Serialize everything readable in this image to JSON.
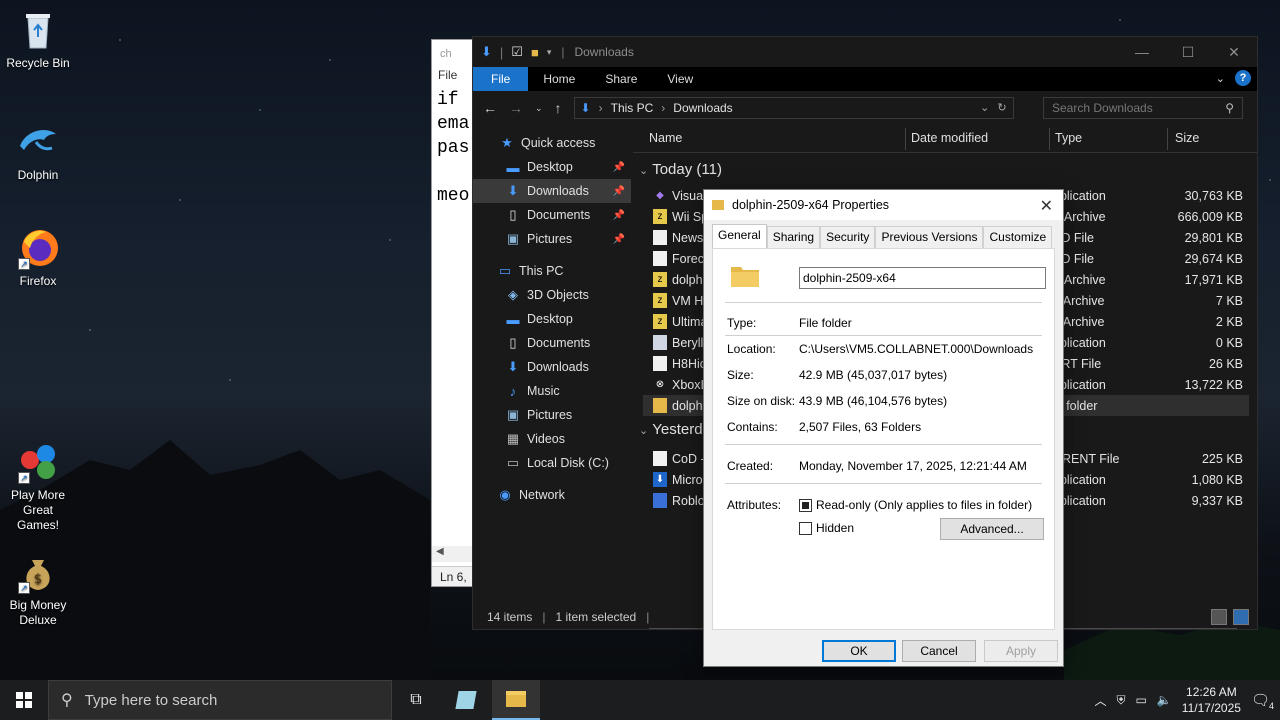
{
  "desktop": {
    "icons": [
      {
        "label": "Recycle Bin"
      },
      {
        "label": "Dolphin"
      },
      {
        "label": "Firefox"
      },
      {
        "label": "Play More Great Games!"
      },
      {
        "label": "Big Money Deluxe"
      }
    ]
  },
  "notepad": {
    "title": "ch",
    "menu": "File",
    "lines": [
      "if ",
      "",
      "ema",
      "pas",
      "",
      "meo"
    ],
    "status": "Ln 6, C"
  },
  "explorer": {
    "title": "Downloads",
    "ribbon": {
      "file": "File",
      "home": "Home",
      "share": "Share",
      "view": "View",
      "help": "?"
    },
    "address": {
      "crumb1": "This PC",
      "crumb2": "Downloads"
    },
    "search_placeholder": "Search Downloads",
    "nav": [
      {
        "label": "Quick access",
        "icon": "star-icon"
      },
      {
        "label": "Desktop",
        "icon": "desktop-icon",
        "pinned": true
      },
      {
        "label": "Downloads",
        "icon": "download-icon",
        "pinned": true
      },
      {
        "label": "Documents",
        "icon": "document-icon",
        "pinned": true
      },
      {
        "label": "Pictures",
        "icon": "pictures-icon",
        "pinned": true
      },
      {
        "label": "This PC",
        "icon": "computer-icon"
      },
      {
        "label": "3D Objects",
        "icon": "cube-icon"
      },
      {
        "label": "Desktop",
        "icon": "desktop-icon"
      },
      {
        "label": "Documents",
        "icon": "document-icon"
      },
      {
        "label": "Downloads",
        "icon": "download-icon"
      },
      {
        "label": "Music",
        "icon": "music-icon"
      },
      {
        "label": "Pictures",
        "icon": "pictures-icon"
      },
      {
        "label": "Videos",
        "icon": "video-icon"
      },
      {
        "label": "Local Disk (C:)",
        "icon": "drive-icon"
      },
      {
        "label": "Network",
        "icon": "network-icon"
      }
    ],
    "columns": {
      "name": "Name",
      "date": "Date modified",
      "type": "Type",
      "size": "Size"
    },
    "groups": {
      "today": "Today (11)",
      "yesterday": "Yesterd"
    },
    "today_rows": [
      {
        "name": "Visual",
        "type": "pplication",
        "size": "30,763 KB"
      },
      {
        "name": "Wii Sp",
        "type": "P Archive",
        "size": "666,009 KB"
      },
      {
        "name": "News",
        "type": "AD File",
        "size": "29,801 KB"
      },
      {
        "name": "Foreca",
        "type": "AD File",
        "size": "29,674 KB"
      },
      {
        "name": "dolph",
        "type": "P Archive",
        "size": "17,971 KB"
      },
      {
        "name": "VM HA",
        "type": "p Archive",
        "size": "7 KB"
      },
      {
        "name": "Ultima",
        "type": "p Archive",
        "size": "2 KB"
      },
      {
        "name": "Berylli",
        "type": "pplication",
        "size": "0 KB"
      },
      {
        "name": "H8Hic",
        "type": "ART File",
        "size": "26 KB"
      },
      {
        "name": "XboxIr",
        "type": "pplication",
        "size": "13,722 KB"
      },
      {
        "name": "dolph",
        "type": "le folder",
        "size": ""
      }
    ],
    "yesterday_rows": [
      {
        "name": "CoD -",
        "type": "RRENT File",
        "size": "225 KB"
      },
      {
        "name": "Micros",
        "type": "pplication",
        "size": "1,080 KB"
      },
      {
        "name": "Roblo",
        "type": "pplication",
        "size": "9,337 KB"
      }
    ],
    "status": {
      "items": "14 items",
      "selected": "1 item selected"
    }
  },
  "properties": {
    "title": "dolphin-2509-x64 Properties",
    "tabs": [
      "General",
      "Sharing",
      "Security",
      "Previous Versions",
      "Customize"
    ],
    "name": "dolphin-2509-x64",
    "type_label": "Type:",
    "type_value": "File folder",
    "location_label": "Location:",
    "location_value": "C:\\Users\\VM5.COLLABNET.000\\Downloads",
    "size_label": "Size:",
    "size_value": "42.9 MB (45,037,017 bytes)",
    "sizeondisk_label": "Size on disk:",
    "sizeondisk_value": "43.9 MB (46,104,576 bytes)",
    "contains_label": "Contains:",
    "contains_value": "2,507 Files, 63 Folders",
    "created_label": "Created:",
    "created_value": "Monday, November 17, 2025, 12:21:44 AM",
    "attributes_label": "Attributes:",
    "readonly_label": "Read-only (Only applies to files in folder)",
    "hidden_label": "Hidden",
    "advanced_label": "Advanced...",
    "ok": "OK",
    "cancel": "Cancel",
    "apply": "Apply"
  },
  "taskbar": {
    "search_placeholder": "Type here to search",
    "time": "12:26 AM",
    "date": "11/17/2025",
    "notifications": "4"
  }
}
